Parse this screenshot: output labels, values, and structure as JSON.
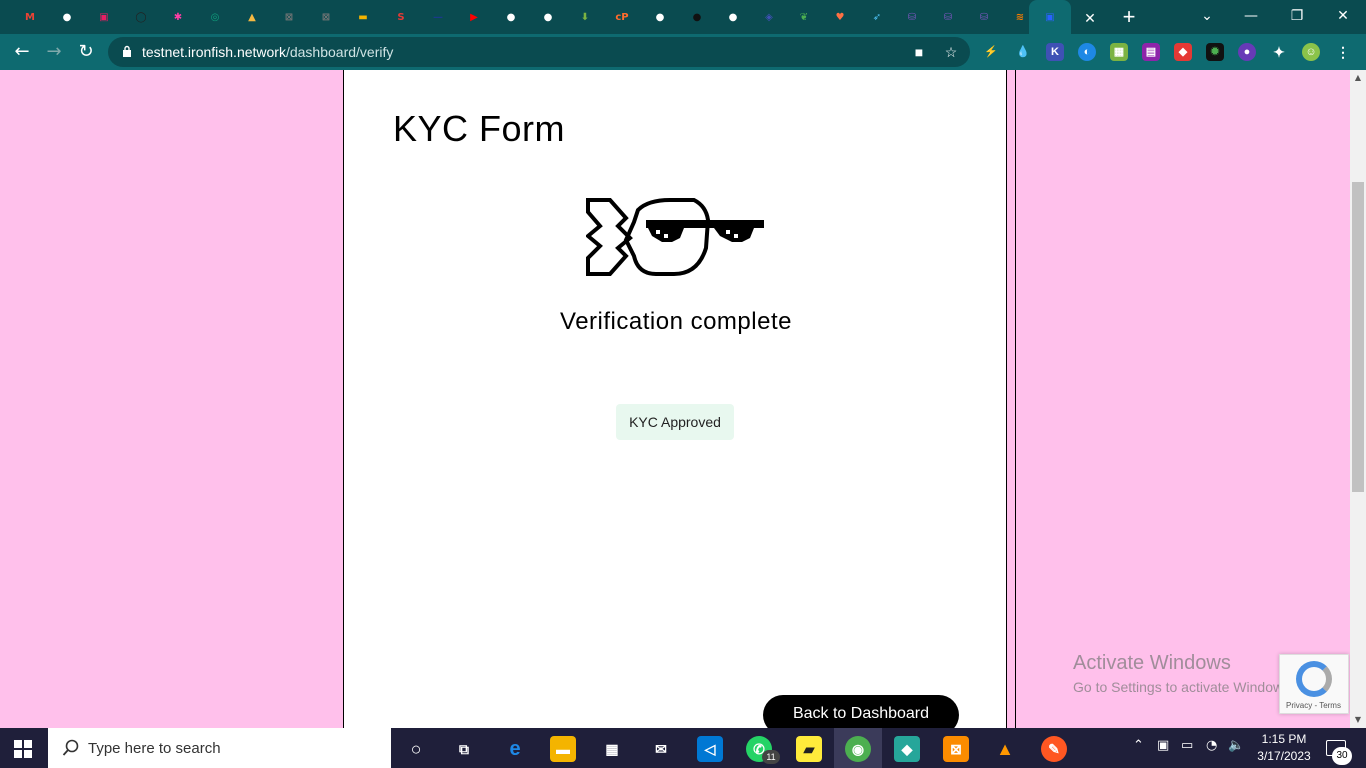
{
  "browser": {
    "url_host": "testnet.ironfish.network",
    "url_path": "/dashboard/verify",
    "tabs": [
      {
        "icon": "gmail-icon",
        "color": "#ea4335",
        "glyph": "M"
      },
      {
        "icon": "globe-icon",
        "color": "#ffffff",
        "glyph": "●"
      },
      {
        "icon": "app-icon",
        "color": "#e91e63",
        "glyph": "▣"
      },
      {
        "icon": "github-icon",
        "color": "#222222",
        "glyph": "◯"
      },
      {
        "icon": "starred-icon",
        "color": "#ff3ea5",
        "glyph": "✱"
      },
      {
        "icon": "chatgpt-icon",
        "color": "#10a37f",
        "glyph": "◎"
      },
      {
        "icon": "sail-icon",
        "color": "#f5b942",
        "glyph": "▲"
      },
      {
        "icon": "crossed-icon",
        "color": "#777777",
        "glyph": "⊠"
      },
      {
        "icon": "crossed-icon",
        "color": "#777777",
        "glyph": "⊠"
      },
      {
        "icon": "folder-icon",
        "color": "#f4b400",
        "glyph": "▬"
      },
      {
        "icon": "s-icon",
        "color": "#e53935",
        "glyph": "S"
      },
      {
        "icon": "dash-icon",
        "color": "#1a3a8a",
        "glyph": "—"
      },
      {
        "icon": "youtube-icon",
        "color": "#ff0000",
        "glyph": "▶"
      },
      {
        "icon": "globe-icon",
        "color": "#ffffff",
        "glyph": "●"
      },
      {
        "icon": "globe-icon",
        "color": "#ffffff",
        "glyph": "●"
      },
      {
        "icon": "download-icon",
        "color": "#7cb342",
        "glyph": "⬇"
      },
      {
        "icon": "cpanel-icon",
        "color": "#ff6c2c",
        "glyph": "cP"
      },
      {
        "icon": "globe-icon",
        "color": "#ffffff",
        "glyph": "●"
      },
      {
        "icon": "dark-circle-icon",
        "color": "#111111",
        "glyph": "●"
      },
      {
        "icon": "globe-icon",
        "color": "#ffffff",
        "glyph": "●"
      },
      {
        "icon": "layers-icon",
        "color": "#3f51b5",
        "glyph": "◈"
      },
      {
        "icon": "leaf-icon",
        "color": "#4caf50",
        "glyph": "❦"
      },
      {
        "icon": "heart-icon",
        "color": "#ff7043",
        "glyph": "♥"
      },
      {
        "icon": "rocket-icon",
        "color": "#4fc3f7",
        "glyph": "➶"
      },
      {
        "icon": "ironfish-icon",
        "color": "#7e57c2",
        "glyph": "⛁"
      },
      {
        "icon": "ironfish-icon",
        "color": "#7e57c2",
        "glyph": "⛁"
      },
      {
        "icon": "ironfish-icon",
        "color": "#7e57c2",
        "glyph": "⛁"
      },
      {
        "icon": "stack-icon",
        "color": "#f57c00",
        "glyph": "≋"
      },
      {
        "icon": "ironfish-active-icon",
        "color": "#2962ff",
        "glyph": "▣",
        "active": true
      }
    ]
  },
  "page": {
    "title": "KYC Form",
    "status_text": "Verification complete",
    "badge": "KYC Approved",
    "back_button": "Back to Dashboard"
  },
  "overlay": {
    "activate_title": "Activate Windows",
    "activate_sub": "Go to Settings to activate Windows.",
    "recaptcha_links": "Privacy - Terms"
  },
  "taskbar": {
    "search_placeholder": "Type here to search",
    "time": "1:15 PM",
    "date": "3/17/2023",
    "whatsapp_badge": "11",
    "notification_count": "30"
  }
}
